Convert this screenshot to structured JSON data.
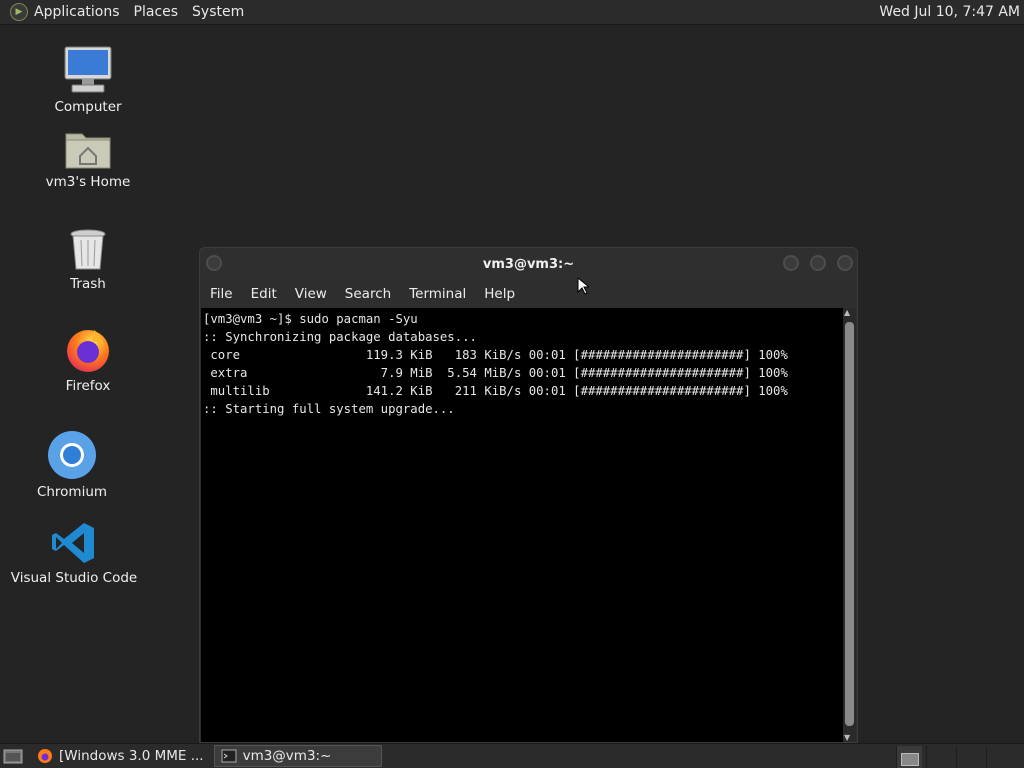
{
  "top_panel": {
    "menus": [
      "Applications",
      "Places",
      "System"
    ],
    "clock": "Wed Jul 10,  7:47 AM"
  },
  "desktop": {
    "icons": [
      {
        "label": "Computer",
        "icon": "computer-icon"
      },
      {
        "label": "vm3's Home",
        "icon": "home-folder-icon"
      },
      {
        "label": "Trash",
        "icon": "trash-icon"
      },
      {
        "label": "Firefox",
        "icon": "firefox-icon"
      },
      {
        "label": "Chromium",
        "icon": "chromium-icon"
      },
      {
        "label": "Visual Studio Code",
        "icon": "vscode-icon"
      }
    ]
  },
  "terminal": {
    "title": "vm3@vm3:~",
    "menu": [
      "File",
      "Edit",
      "View",
      "Search",
      "Terminal",
      "Help"
    ],
    "lines": [
      "[vm3@vm3 ~]$ sudo pacman -Syu",
      ":: Synchronizing package databases...",
      " core                 119.3 KiB   183 KiB/s 00:01 [######################] 100%",
      " extra                  7.9 MiB  5.54 MiB/s 00:01 [######################] 100%",
      " multilib             141.2 KiB   211 KiB/s 00:01 [######################] 100%",
      ":: Starting full system upgrade..."
    ]
  },
  "taskbar": {
    "tasks": [
      {
        "label": "[Windows 3.0 MME ...",
        "icon": "firefox-icon",
        "active": false
      },
      {
        "label": "vm3@vm3:~",
        "icon": "terminal-icon",
        "active": true
      }
    ]
  },
  "colors": {
    "desktop_bg": "#242424",
    "terminal_bg": "#000000",
    "panel_bg": "#2b2b2b"
  }
}
